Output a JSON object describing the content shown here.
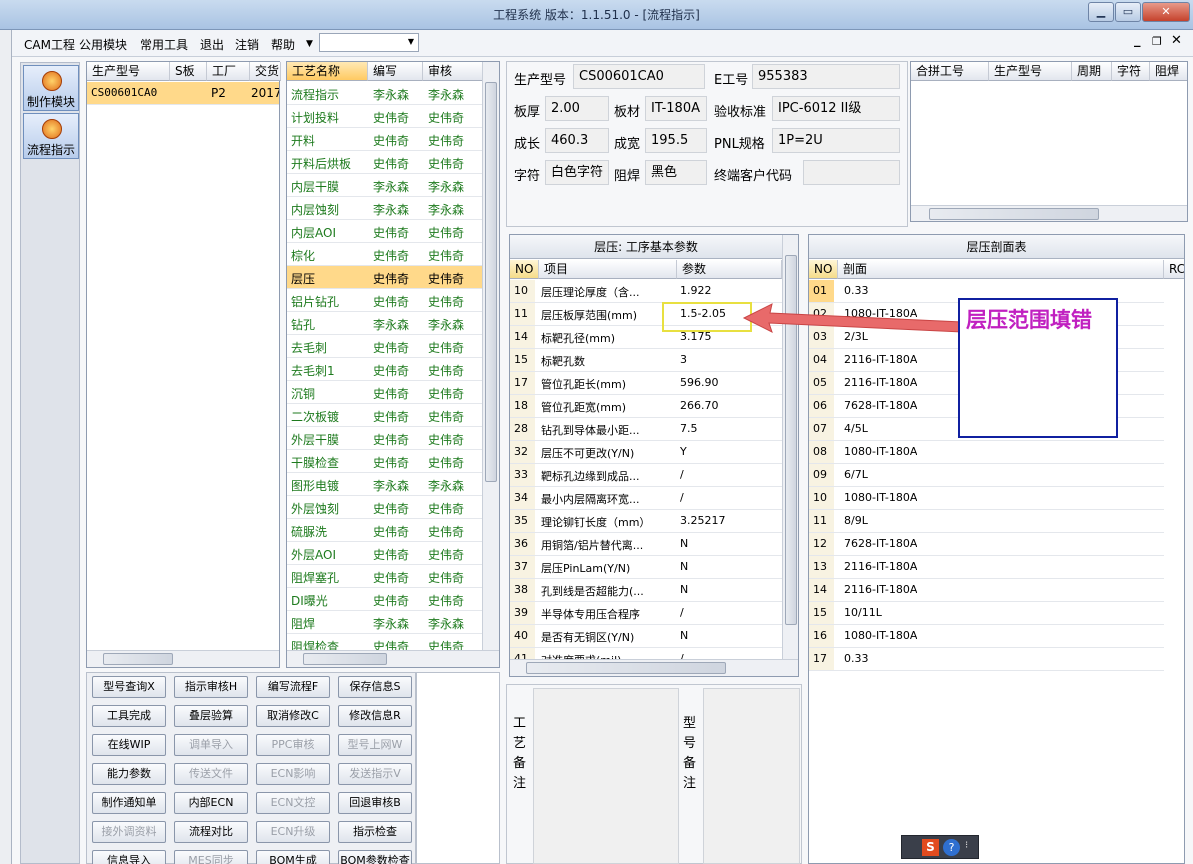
{
  "window": {
    "title": "工程系统   版本：1.1.51.0 - [流程指示]"
  },
  "menu": [
    "CAM工程",
    "公用模块",
    "常用工具",
    "退出",
    "注销",
    "帮助"
  ],
  "nav": [
    {
      "label": "制作模块"
    },
    {
      "label": "流程指示"
    }
  ],
  "model_grid": {
    "headers": [
      "生产型号",
      "S板",
      "工厂",
      "交货"
    ],
    "rows": [
      [
        "CS00601CA0",
        "",
        "P2",
        "2017"
      ]
    ]
  },
  "process_grid": {
    "headers": [
      "工艺名称",
      "编写",
      "审核"
    ],
    "rows": [
      [
        "流程指示",
        "李永森",
        "李永森"
      ],
      [
        "计划投料",
        "史伟奇",
        "史伟奇"
      ],
      [
        "开料",
        "史伟奇",
        "史伟奇"
      ],
      [
        "开料后烘板",
        "史伟奇",
        "史伟奇"
      ],
      [
        "内层干膜",
        "李永森",
        "李永森"
      ],
      [
        "内层蚀刻",
        "李永森",
        "李永森"
      ],
      [
        "内层AOI",
        "史伟奇",
        "史伟奇"
      ],
      [
        "棕化",
        "史伟奇",
        "史伟奇"
      ],
      [
        "层压",
        "史伟奇",
        "史伟奇"
      ],
      [
        "铝片钻孔",
        "史伟奇",
        "史伟奇"
      ],
      [
        "钻孔",
        "李永森",
        "李永森"
      ],
      [
        "去毛刺",
        "史伟奇",
        "史伟奇"
      ],
      [
        "去毛刺1",
        "史伟奇",
        "史伟奇"
      ],
      [
        "沉铜",
        "史伟奇",
        "史伟奇"
      ],
      [
        "二次板镀",
        "史伟奇",
        "史伟奇"
      ],
      [
        "外层干膜",
        "史伟奇",
        "史伟奇"
      ],
      [
        "干膜检查",
        "史伟奇",
        "史伟奇"
      ],
      [
        "图形电镀",
        "李永森",
        "李永森"
      ],
      [
        "外层蚀刻",
        "史伟奇",
        "史伟奇"
      ],
      [
        "硫脲洗",
        "史伟奇",
        "史伟奇"
      ],
      [
        "外层AOI",
        "史伟奇",
        "史伟奇"
      ],
      [
        "阻焊塞孔",
        "史伟奇",
        "史伟奇"
      ],
      [
        "DI曝光",
        "史伟奇",
        "史伟奇"
      ],
      [
        "阻焊",
        "李永森",
        "李永森"
      ],
      [
        "阻焊检查",
        "史伟奇",
        "史伟奇"
      ]
    ]
  },
  "buttons": [
    {
      "label": "型号查询X",
      "enabled": true
    },
    {
      "label": "指示审核H",
      "enabled": true
    },
    {
      "label": "编写流程F",
      "enabled": true
    },
    {
      "label": "保存信息S",
      "enabled": true
    },
    {
      "label": "工具完成",
      "enabled": true
    },
    {
      "label": "叠层验算",
      "enabled": true
    },
    {
      "label": "取消修改C",
      "enabled": true
    },
    {
      "label": "修改信息R",
      "enabled": true
    },
    {
      "label": "在线WIP",
      "enabled": true
    },
    {
      "label": "调单导入",
      "enabled": false
    },
    {
      "label": "PPC审核",
      "enabled": false
    },
    {
      "label": "型号上网W",
      "enabled": false
    },
    {
      "label": "能力参数",
      "enabled": true
    },
    {
      "label": "传送文件",
      "enabled": false
    },
    {
      "label": "ECN影响",
      "enabled": false
    },
    {
      "label": "发送指示V",
      "enabled": false
    },
    {
      "label": "制作通知单",
      "enabled": true
    },
    {
      "label": "内部ECN",
      "enabled": true
    },
    {
      "label": "ECN文控",
      "enabled": false
    },
    {
      "label": "回退审核B",
      "enabled": true
    },
    {
      "label": "接外调资料",
      "enabled": false
    },
    {
      "label": "流程对比",
      "enabled": true
    },
    {
      "label": "ECN升级",
      "enabled": false
    },
    {
      "label": "指示检查",
      "enabled": true
    },
    {
      "label": "信息导入",
      "enabled": true
    },
    {
      "label": "MES同步",
      "enabled": false
    },
    {
      "label": "BOM生成",
      "enabled": true
    },
    {
      "label": "BOM参数检查",
      "enabled": true
    }
  ],
  "info": {
    "production_model": {
      "label": "生产型号",
      "value": "CS00601CA0"
    },
    "e_number": {
      "label": "E工号",
      "value": "955383"
    },
    "thickness": {
      "label": "板厚",
      "value": "2.00"
    },
    "material": {
      "label": "板材",
      "value": "IT-180A"
    },
    "acceptance": {
      "label": "验收标准",
      "value": "IPC-6012 II级"
    },
    "length": {
      "label": "成长",
      "value": "460.3"
    },
    "width": {
      "label": "成宽",
      "value": "195.5"
    },
    "pnl": {
      "label": "PNL规格",
      "value": "1P=2U"
    },
    "legend": {
      "label": "字符",
      "value": "白色字符"
    },
    "solder_mask": {
      "label": "阻焊",
      "value": "黑色"
    },
    "customer_code": {
      "label": "终端客户代码",
      "value": ""
    }
  },
  "merge_grid": {
    "headers": [
      "合拼工号",
      "生产型号",
      "周期",
      "字符",
      "阻焊"
    ]
  },
  "params": {
    "title": "层压: 工序基本参数",
    "headers": [
      "NO",
      "项目",
      "参数"
    ],
    "rows": [
      [
        "10",
        "层压理论厚度（含...",
        "1.922"
      ],
      [
        "11",
        "层压板厚范围(mm)",
        "1.5-2.05"
      ],
      [
        "14",
        "标靶孔径(mm)",
        "3.175"
      ],
      [
        "15",
        "标靶孔数",
        "3"
      ],
      [
        "17",
        "管位孔距长(mm)",
        "596.90"
      ],
      [
        "18",
        "管位孔距宽(mm)",
        "266.70"
      ],
      [
        "28",
        "钻孔到导体最小距...",
        "7.5"
      ],
      [
        "32",
        "层压不可更改(Y/N)",
        "Y"
      ],
      [
        "33",
        "靶标孔边缘到成品...",
        "/"
      ],
      [
        "34",
        "最小内层隔离环宽...",
        "/"
      ],
      [
        "35",
        "理论铆钉长度（mm）",
        "3.25217"
      ],
      [
        "36",
        "用铜箔/铝片替代离...",
        "N"
      ],
      [
        "37",
        "层压PinLam(Y/N)",
        "N"
      ],
      [
        "38",
        "孔到线是否超能力(...",
        "N"
      ],
      [
        "39",
        "半导体专用压合程序",
        "/"
      ],
      [
        "40",
        "是否有无铜区(Y/N)",
        "N"
      ],
      [
        "41",
        "对准度要求(mil)",
        "/"
      ]
    ]
  },
  "section": {
    "title": "层压剖面表",
    "headers": [
      "NO",
      "剖面",
      "RC%"
    ],
    "rows": [
      [
        "01",
        "0.33"
      ],
      [
        "02",
        "1080-IT-180A"
      ],
      [
        "03",
        "2/3L"
      ],
      [
        "04",
        "2116-IT-180A"
      ],
      [
        "05",
        "2116-IT-180A"
      ],
      [
        "06",
        "7628-IT-180A"
      ],
      [
        "07",
        "4/5L"
      ],
      [
        "08",
        "1080-IT-180A"
      ],
      [
        "09",
        "6/7L"
      ],
      [
        "10",
        "1080-IT-180A"
      ],
      [
        "11",
        "8/9L"
      ],
      [
        "12",
        "7628-IT-180A"
      ],
      [
        "13",
        "2116-IT-180A"
      ],
      [
        "14",
        "2116-IT-180A"
      ],
      [
        "15",
        "10/11L"
      ],
      [
        "16",
        "1080-IT-180A"
      ],
      [
        "17",
        "0.33"
      ]
    ]
  },
  "notes": {
    "process_label": "工艺备注",
    "model_label": "型号备注"
  },
  "annotation": {
    "text": "层压范围填错"
  }
}
